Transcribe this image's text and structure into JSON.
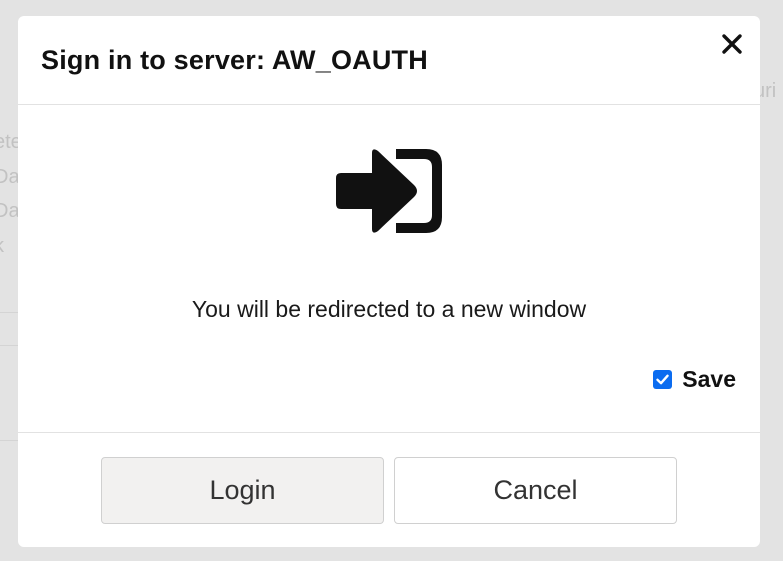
{
  "background": {
    "fragments": [
      "ete",
      "Da",
      "Da",
      "k",
      "uri"
    ]
  },
  "dialog": {
    "title": "Sign in to server: AW_OAUTH",
    "close_icon": "close-icon",
    "signin_icon": "sign-in-icon",
    "message": "You will be redirected to a new window",
    "save": {
      "label": "Save",
      "checked": true
    },
    "buttons": {
      "login": "Login",
      "cancel": "Cancel"
    }
  },
  "colors": {
    "accent": "#0b6cf0",
    "overlay": "#e3e3e3",
    "login_bg": "#f2f1f0"
  }
}
